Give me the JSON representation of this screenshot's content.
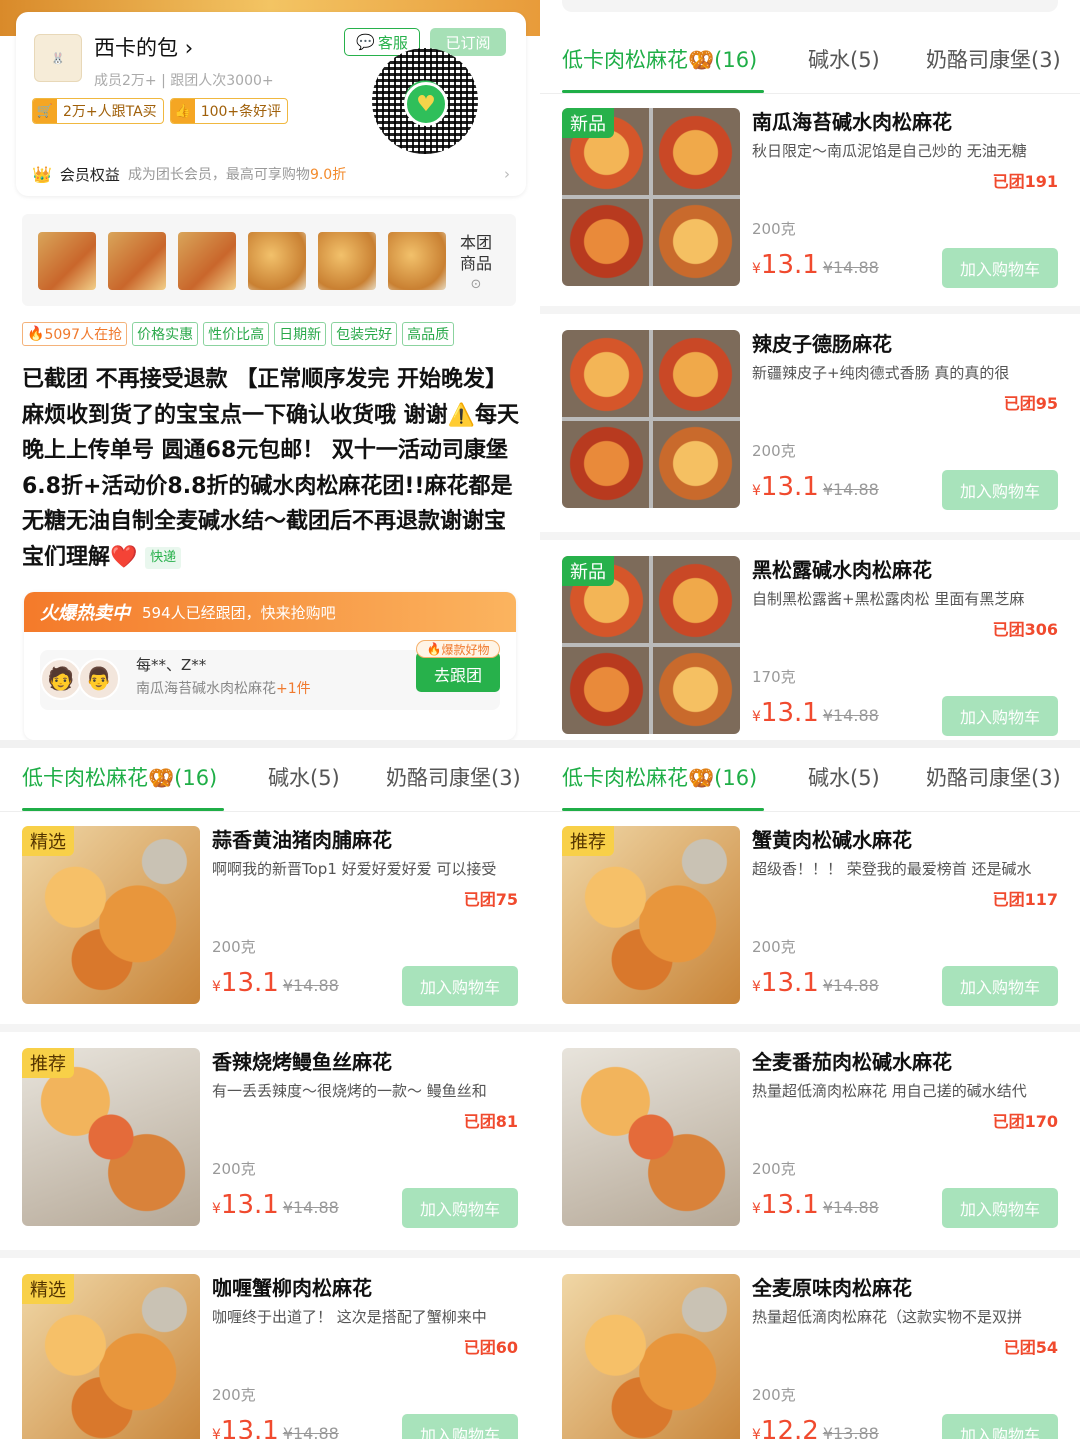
{
  "store": {
    "name": "西卡的包",
    "meta": "成员2万+ | 跟团人次3000+",
    "tag1": "2万+人跟TA买",
    "tag2": "100+条好评",
    "btn_service": "客服",
    "btn_subscribed": "已订阅",
    "member_label": "会员权益",
    "member_desc_pre": "成为团长会员，最高可享购物",
    "member_discount": "9.0折",
    "goods_label": "本团商品"
  },
  "promo_tags": [
    {
      "label": "5097人在抢",
      "hot": true
    },
    {
      "label": "价格实惠",
      "hot": false
    },
    {
      "label": "性价比高",
      "hot": false
    },
    {
      "label": "日期新",
      "hot": false
    },
    {
      "label": "包装完好",
      "hot": false
    },
    {
      "label": "高品质",
      "hot": false
    }
  ],
  "description": "已截团 不再接受退款 【正常顺序发完 开始晚发】麻烦收到货了的宝宝点一下确认收货哦 谢谢⚠️每天晚上上传单号 圆通68元包邮！ 双十一活动司康堡6.8折+活动价8.8折的碱水肉松麻花团!!麻花都是无糖无油自制全麦碱水结～截团后不再退款谢谢宝宝们理解❤️",
  "delivery_tag": "快递",
  "hot": {
    "title": "火爆热卖中",
    "subtitle": "594人已经跟团，快来抢购吧",
    "buyers": "每**、Z**",
    "product": "南瓜海苔碱水肉松麻花",
    "extra": "+1件",
    "badge": "爆款好物",
    "button": "去跟团"
  },
  "tabs": [
    {
      "label": "低卡肉松麻花🥨(16)",
      "active": true
    },
    {
      "label": "碱水(5)",
      "active": false
    },
    {
      "label": "奶酪司康堡(3)",
      "active": false
    }
  ],
  "currency": "¥",
  "add_cart": "加入购物车",
  "products_top": [
    {
      "badge": "新品",
      "title": "南瓜海苔碱水肉松麻花",
      "desc": "秋日限定～南瓜泥馅是自己炒的 无油无糖",
      "sold": "已团191",
      "weight": "200克",
      "price": "13.1",
      "old": "¥14.88"
    },
    {
      "badge": "",
      "title": "辣皮子德肠麻花",
      "desc": "新疆辣皮子+纯肉德式香肠 真的真的很",
      "sold": "已团95",
      "weight": "200克",
      "price": "13.1",
      "old": "¥14.88"
    },
    {
      "badge": "新品",
      "title": "黑松露碱水肉松麻花",
      "desc": "自制黑松露酱+黑松露肉松 里面有黑芝麻",
      "sold": "已团306",
      "weight": "170克",
      "price": "13.1",
      "old": "¥14.88"
    }
  ],
  "products_left": [
    {
      "badge": "精选",
      "title": "蒜香黄油猪肉脯麻花",
      "desc": "啊啊我的新晋Top1 好爱好爱好爱 可以接受",
      "sold": "已团75",
      "weight": "200克",
      "price": "13.1",
      "old": "¥14.88"
    },
    {
      "badge": "推荐",
      "title": "香辣烧烤鳗鱼丝麻花",
      "desc": "有一丢丢辣度～很烧烤的一款～ 鳗鱼丝和",
      "sold": "已团81",
      "weight": "200克",
      "price": "13.1",
      "old": "¥14.88"
    },
    {
      "badge": "精选",
      "title": "咖喱蟹柳肉松麻花",
      "desc": "咖喱终于出道了！ 这次是搭配了蟹柳来中",
      "sold": "已团60",
      "weight": "200克",
      "price": "13.1",
      "old": "¥14.88"
    }
  ],
  "products_right": [
    {
      "badge": "推荐",
      "title": "蟹黄肉松碱水麻花",
      "desc": "超级香！！！ 荣登我的最爱榜首 还是碱水",
      "sold": "已团117",
      "weight": "200克",
      "price": "13.1",
      "old": "¥14.88"
    },
    {
      "badge": "",
      "title": "全麦番茄肉松碱水麻花",
      "desc": "热量超低滴肉松麻花 用自己搓的碱水结代",
      "sold": "已团170",
      "weight": "200克",
      "price": "13.1",
      "old": "¥14.88"
    },
    {
      "badge": "",
      "title": "全麦原味肉松麻花",
      "desc": "热量超低滴肉松麻花（这款实物不是双拼",
      "sold": "已团54",
      "weight": "200克",
      "price": "12.2",
      "old": "¥13.88"
    }
  ]
}
